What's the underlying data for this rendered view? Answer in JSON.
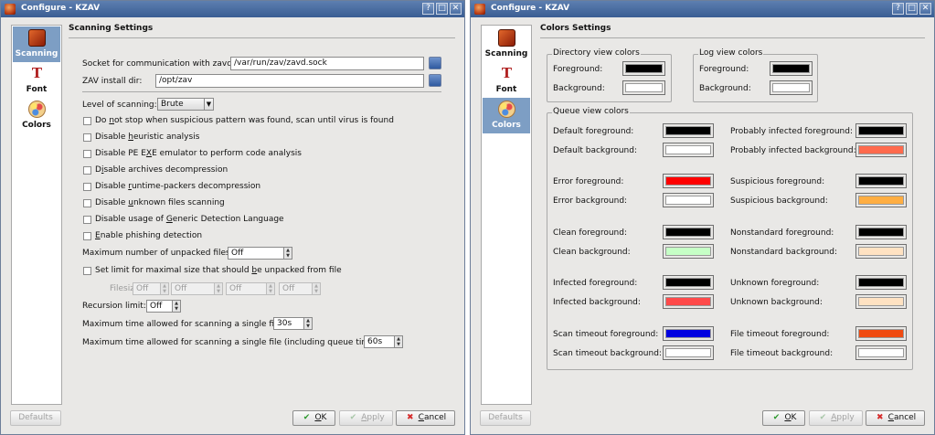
{
  "app": {
    "title": "Configure - KZAV",
    "window_controls": {
      "help": "?",
      "maximize": "□",
      "close": "✕"
    }
  },
  "sidebar": {
    "items": [
      {
        "label": "Scanning",
        "icon": "shield-icon"
      },
      {
        "label": "Font",
        "icon": "font-icon"
      },
      {
        "label": "Colors",
        "icon": "palette-icon"
      }
    ]
  },
  "scanning": {
    "title": "Scanning Settings",
    "socket_label": "Socket for communication with zavd:",
    "socket_value": "/var/run/zav/zavd.sock",
    "install_label": "ZAV install dir:",
    "install_value": "/opt/zav",
    "level_label": "Level of scanning:",
    "level_value": "Brute",
    "checks": {
      "c0": {
        "pre": "Do ",
        "u": "n",
        "post": "ot stop when suspicious pattern was found, scan until virus is found"
      },
      "c1": {
        "pre": "Disable ",
        "u": "h",
        "post": "euristic analysis"
      },
      "c2": {
        "pre": "Disable PE E",
        "u": "X",
        "post": "E emulator to perform code analysis"
      },
      "c3": {
        "pre": "D",
        "u": "i",
        "post": "sable archives decompression"
      },
      "c4": {
        "pre": "Disable ",
        "u": "r",
        "post": "untime-packers decompression"
      },
      "c5": {
        "pre": "Disable ",
        "u": "u",
        "post": "nknown files scanning"
      },
      "c6": {
        "pre": "Disable usage of ",
        "u": "G",
        "post": "eneric Detection Language"
      },
      "c7": {
        "pre": "",
        "u": "E",
        "post": "nable phishing detection"
      }
    },
    "max_unpacked_label": "Maximum number of unpacked files:",
    "max_unpacked_value": "Off",
    "size_limit": {
      "pre": "Set limit for maximal size that should ",
      "u": "b",
      "post": "e unpacked from file"
    },
    "filesize_label": "Filesize:",
    "filesize_values": [
      "Off",
      "Off",
      "Off",
      "Off"
    ],
    "recursion_label": "Recursion limit:",
    "recursion_value": "Off",
    "max_time_label": "Maximum time allowed for scanning a single file:",
    "max_time_value": "30s",
    "max_time_queue_label": "Maximum time allowed for scanning a single file (including queue time):",
    "max_time_queue_value": "60s"
  },
  "colors": {
    "title": "Colors Settings",
    "directory": {
      "title": "Directory view colors",
      "rows": [
        {
          "label": "Foreground:",
          "color": "#000000"
        },
        {
          "label": "Background:",
          "color": "#ffffff"
        }
      ]
    },
    "log": {
      "title": "Log view colors",
      "rows": [
        {
          "label": "Foreground:",
          "color": "#000000"
        },
        {
          "label": "Background:",
          "color": "#ffffff"
        }
      ]
    },
    "queue": {
      "title": "Queue view colors",
      "left": [
        {
          "label": "Default foreground:",
          "color": "#000000"
        },
        {
          "label": "Default background:",
          "color": "#ffffff"
        },
        {
          "label": "Error foreground:",
          "color": "#ff0000"
        },
        {
          "label": "Error background:",
          "color": "#ffffff"
        },
        {
          "label": "Clean foreground:",
          "color": "#000000"
        },
        {
          "label": "Clean background:",
          "color": "#c6ffc6"
        },
        {
          "label": "Infected foreground:",
          "color": "#000000"
        },
        {
          "label": "Infected background:",
          "color": "#ff4a4a"
        },
        {
          "label": "Scan timeout foreground:",
          "color": "#0000e0"
        },
        {
          "label": "Scan timeout background:",
          "color": "#ffffff"
        }
      ],
      "right": [
        {
          "label": "Probably infected foreground:",
          "color": "#000000"
        },
        {
          "label": "Probably infected background:",
          "color": "#ff6a4d"
        },
        {
          "label": "Suspicious foreground:",
          "color": "#000000"
        },
        {
          "label": "Suspicious background:",
          "color": "#ffae42"
        },
        {
          "label": "Nonstandard foreground:",
          "color": "#000000"
        },
        {
          "label": "Nonstandard background:",
          "color": "#ffe2c2"
        },
        {
          "label": "Unknown foreground:",
          "color": "#000000"
        },
        {
          "label": "Unknown background:",
          "color": "#ffe2c2"
        },
        {
          "label": "File timeout foreground:",
          "color": "#f04a10"
        },
        {
          "label": "File timeout background:",
          "color": "#ffffff"
        }
      ]
    }
  },
  "buttons": {
    "defaults": "Defaults",
    "ok": {
      "pre": "",
      "u": "O",
      "post": "K"
    },
    "apply": {
      "pre": "",
      "u": "A",
      "post": "pply"
    },
    "cancel": {
      "pre": "",
      "u": "C",
      "post": "ancel"
    }
  },
  "accent": {
    "selection": "#7d9ec4",
    "titlebar": "#3a5d93"
  }
}
